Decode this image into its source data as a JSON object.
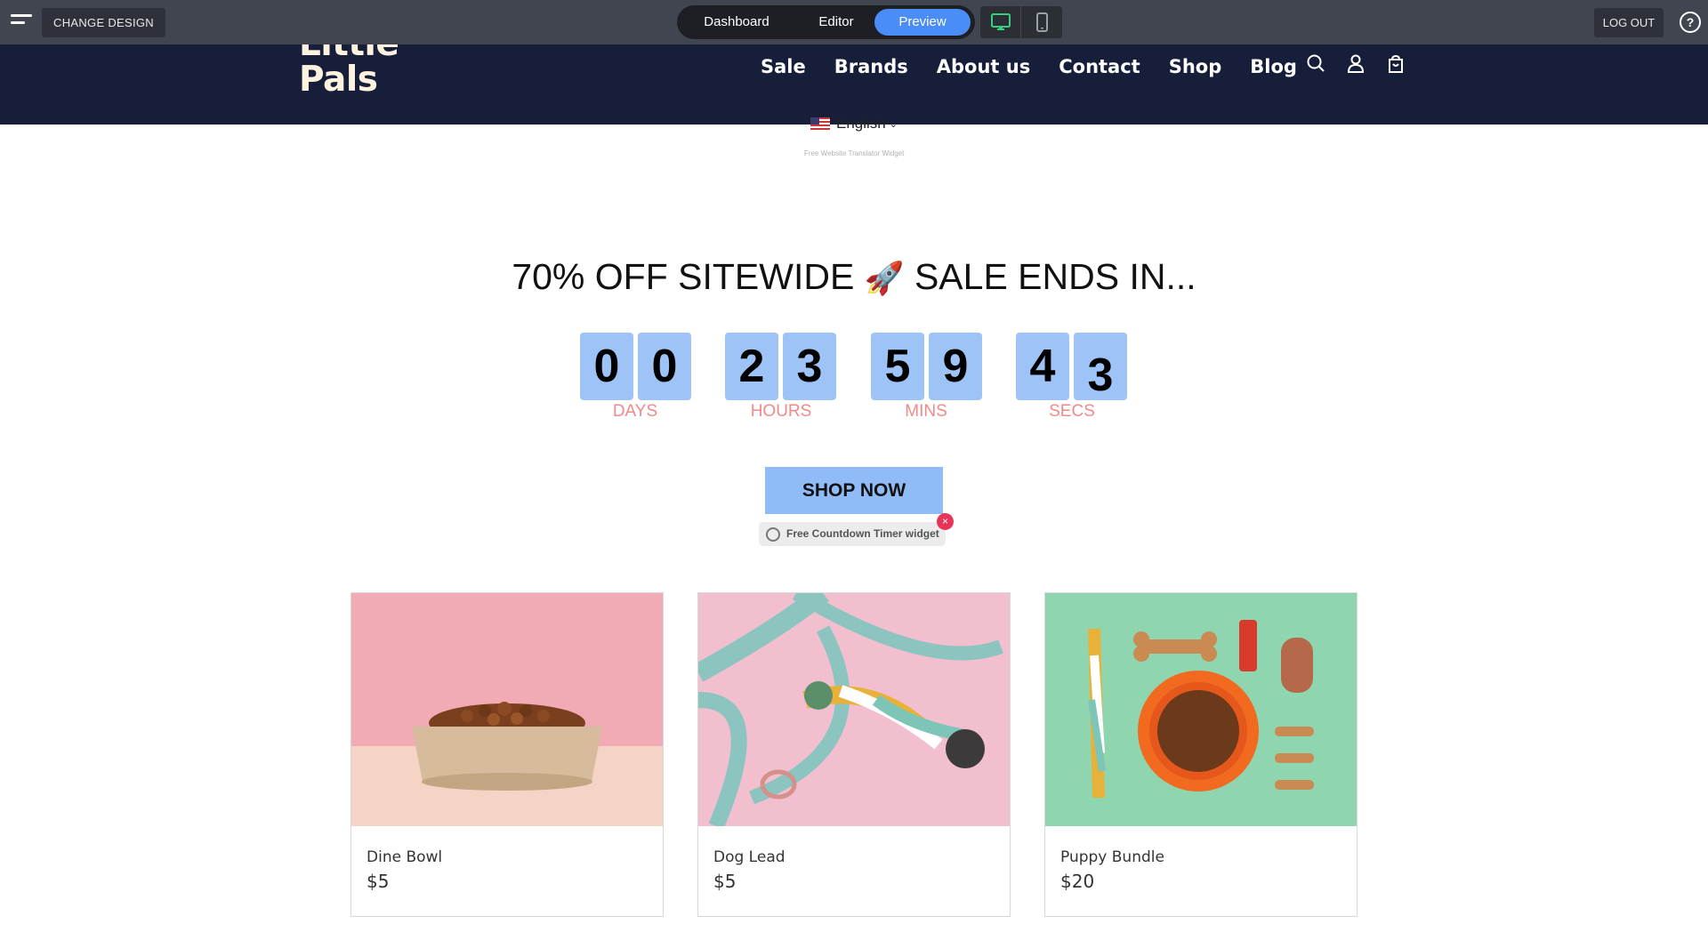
{
  "editor": {
    "change_design": "CHANGE DESIGN",
    "tabs": [
      "Dashboard",
      "Editor",
      "Preview"
    ],
    "active_tab": "Preview",
    "logout": "LOG OUT",
    "help": "?"
  },
  "site": {
    "logo_line1": "Little",
    "logo_line2": "Pals",
    "nav": [
      "Sale",
      "Brands",
      "About us",
      "Contact",
      "Shop",
      "Blog"
    ]
  },
  "translator": {
    "language": "English",
    "widget_label": "Free Website Translator Widget"
  },
  "countdown": {
    "headline_pre": "70% OFF SITEWIDE",
    "headline_post": "SALE ENDS IN...",
    "rocket": "🚀",
    "units": [
      {
        "label": "DAYS",
        "digits": [
          "0",
          "0"
        ]
      },
      {
        "label": "HOURS",
        "digits": [
          "2",
          "3"
        ]
      },
      {
        "label": "MINS",
        "digits": [
          "5",
          "9"
        ]
      },
      {
        "label": "SECS",
        "digits": [
          "4",
          "3"
        ]
      }
    ],
    "button": "SHOP NOW",
    "widget_badge": "Free Countdown Timer widget",
    "close": "×"
  },
  "products": [
    {
      "name": "Dine Bowl",
      "price": "$5"
    },
    {
      "name": "Dog Lead",
      "price": "$5"
    },
    {
      "name": "Puppy Bundle",
      "price": "$20"
    }
  ],
  "colors": {
    "editor_bar": "#414550",
    "header_bg": "#171e3a",
    "digit_bg": "#9ec3f7",
    "unit_label": "#f08a8a",
    "accent_preview": "#4a8df6"
  }
}
